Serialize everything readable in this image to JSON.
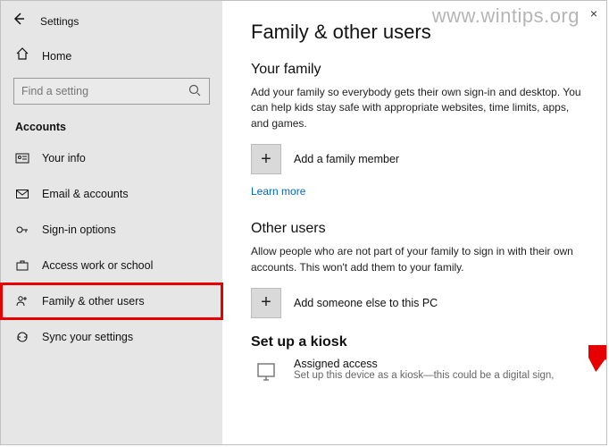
{
  "window": {
    "title": "Settings",
    "close": "×"
  },
  "watermark": "www.wintips.org",
  "sidebar": {
    "home": "Home",
    "search_placeholder": "Find a setting",
    "heading": "Accounts",
    "items": [
      {
        "icon": "user-card-icon",
        "label": "Your info"
      },
      {
        "icon": "mail-icon",
        "label": "Email & accounts"
      },
      {
        "icon": "key-icon",
        "label": "Sign-in options"
      },
      {
        "icon": "briefcase-icon",
        "label": "Access work or school"
      },
      {
        "icon": "people-icon",
        "label": "Family & other users"
      },
      {
        "icon": "sync-icon",
        "label": "Sync your settings"
      }
    ]
  },
  "main": {
    "title": "Family & other users",
    "family": {
      "heading": "Your family",
      "desc": "Add your family so everybody gets their own sign-in and desktop. You can help kids stay safe with appropriate websites, time limits, apps, and games.",
      "add_label": "Add a family member",
      "learn_more": "Learn more"
    },
    "other": {
      "heading": "Other users",
      "desc": "Allow people who are not part of your family to sign in with their own accounts. This won't add them to your family.",
      "add_label": "Add someone else to this PC"
    },
    "kiosk": {
      "heading": "Set up a kiosk",
      "title": "Assigned access",
      "sub": "Set up this device as a kiosk—this could be a digital sign,"
    }
  }
}
